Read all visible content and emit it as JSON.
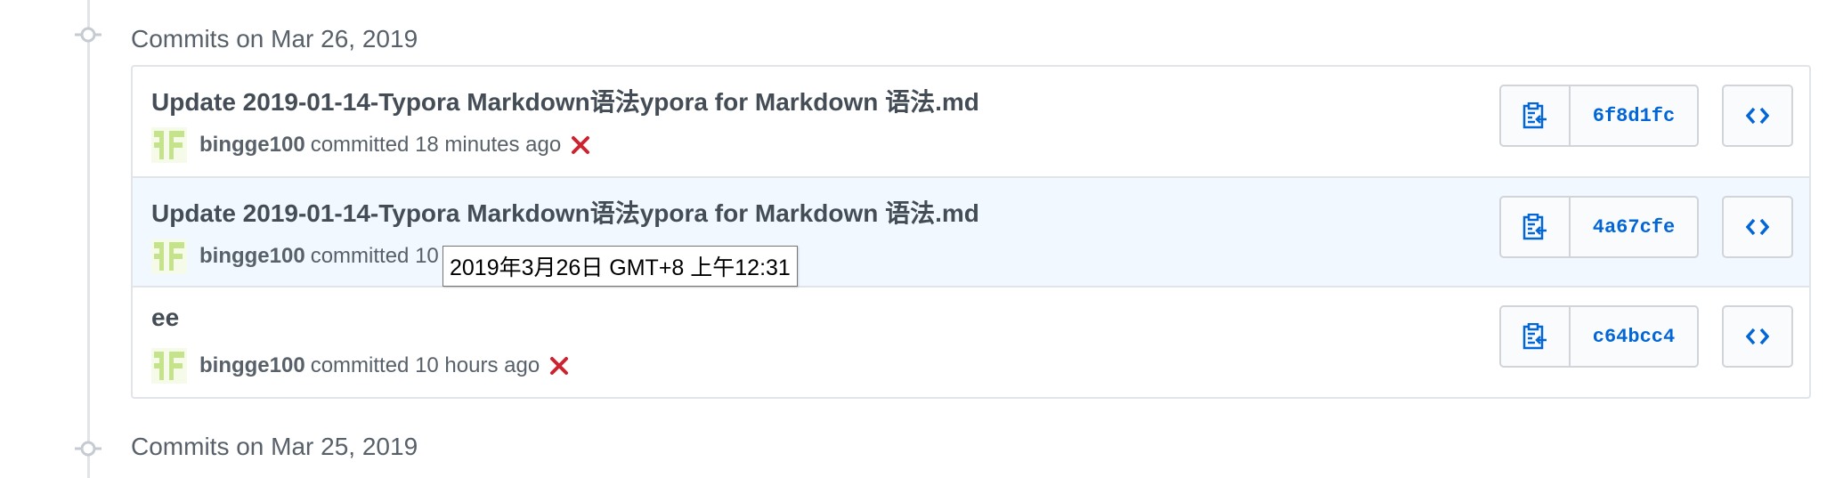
{
  "groups": [
    {
      "header": "Commits on Mar 26, 2019",
      "commits": [
        {
          "message": "Update 2019-01-14-Typora Markdown语法ypora for Markdown 语法.md",
          "author": "bingge100",
          "time_text": "committed 18 minutes ago",
          "status": "failure",
          "sha": "6f8d1fc"
        },
        {
          "message": "Update 2019-01-14-Typora Markdown语法ypora for Markdown 语法.md",
          "author": "bingge100",
          "time_text": "committed 10",
          "status": "",
          "sha": "4a67cfe",
          "highlighted": true
        },
        {
          "message": "ee",
          "author": "bingge100",
          "time_text": "committed 10 hours ago",
          "status": "failure",
          "sha": "c64bcc4"
        }
      ]
    },
    {
      "header": "Commits on Mar 25, 2019"
    }
  ],
  "tooltip": "2019年3月26日 GMT+8 上午12:31",
  "icons": {
    "commit_dot": "git-commit-icon",
    "avatar": "identicon-avatar",
    "status": "x-failure-icon",
    "copy": "clipboard-copy-icon",
    "browse": "code-brackets-icon"
  },
  "colors": {
    "link_blue": "#0366d6",
    "failure_red": "#cb2431",
    "avatar_green": "#c5e38a",
    "highlight_bg": "#f1f8ff",
    "border": "#e1e4e8"
  }
}
